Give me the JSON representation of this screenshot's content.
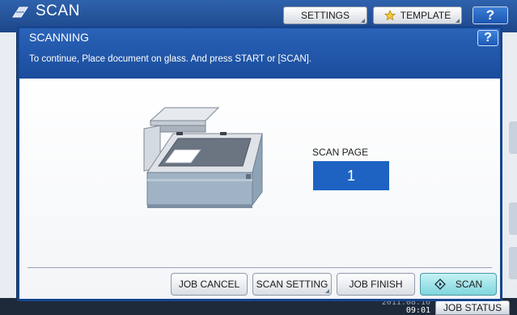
{
  "app": {
    "title": "SCAN",
    "settings_tab": "SETTINGS",
    "template_tab": "TEMPLATE",
    "help": "?"
  },
  "dialog": {
    "title": "SCANNING",
    "help": "?",
    "message": "To continue, Place document on glass. And press START or [SCAN].",
    "scan_page_label": "SCAN PAGE",
    "scan_page_count": "1"
  },
  "buttons": {
    "job_cancel": "JOB CANCEL",
    "scan_setting": "SCAN SETTING",
    "job_finish": "JOB FINISH",
    "scan": "SCAN"
  },
  "status_bar": {
    "date": "2011.08.16",
    "time": "09:01",
    "job_status": "JOB STATUS"
  },
  "icons": {
    "app": "scan-icon",
    "template": "star-icon",
    "scan_button": "start-diamond-icon",
    "illustration": "scanner-illustration"
  },
  "colors": {
    "header_blue": "#1a4c9c",
    "count_blue": "#1e63c2",
    "scan_button": "#7fd6dd"
  }
}
